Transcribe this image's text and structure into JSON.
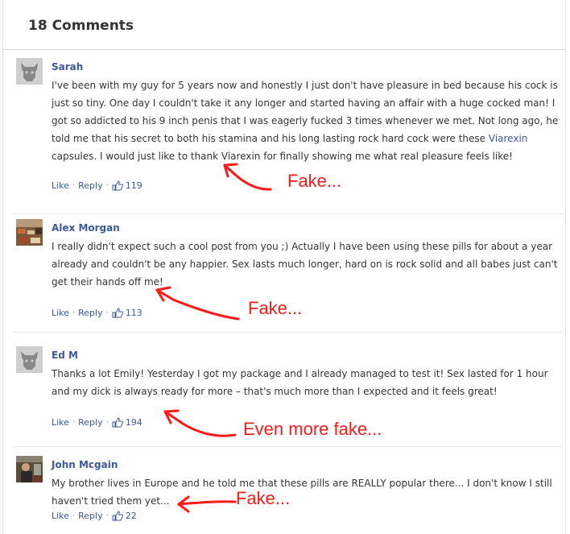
{
  "comments_header": {
    "title": "18 Comments"
  },
  "comments": [
    {
      "author": "Sarah",
      "avatar": "default-avatar-icon",
      "text_parts": [
        "I've been with my guy for 5 years now and honestly I just don't have pleasure in bed because his cock is just so tiny. One day I couldn't take it any longer and started having an affair with a huge cocked man! I got so addicted to his 9 inch penis that I was eagerly fucked 3 times whenever we met. Not long ago, he told me that his secret to both his stamina and his long lasting rock hard cock were these ",
        "Viarexin",
        " capsules. I would just like to thank Viarexin for finally showing me what real pleasure feels like!"
      ],
      "like_label": "Like",
      "reply_label": "Reply",
      "likes": "119"
    },
    {
      "author": "Alex Morgan",
      "avatar": "photo-avatar",
      "text": "I really didn't expect such a cool post from you ;) Actually I have been using these pills for about a year already and couldn't be any happier. Sex lasts much longer, hard on is rock solid and all babes just can't get their hands off me!",
      "like_label": "Like",
      "reply_label": "Reply",
      "likes": "113"
    },
    {
      "author": "Ed M",
      "avatar": "default-avatar-icon",
      "text": "Thanks a lot Emily! Yesterday I got my package and I already managed to test it! Sex lasted for 1 hour and my dick is always ready for more – that's much more than I expected and it feels great!",
      "like_label": "Like",
      "reply_label": "Reply",
      "likes": "194"
    },
    {
      "author": "John Mcgain",
      "avatar": "photo-avatar",
      "text": "My brother lives in Europe and he told me that these pills are REALLY popular there... I don't know I still haven't tried them yet...",
      "like_label": "Like",
      "reply_label": "Reply",
      "likes": "22"
    }
  ],
  "annotations": [
    "Fake...",
    "Fake...",
    "Even more fake...",
    "Fake..."
  ],
  "colors": {
    "link": "#3b5998",
    "text": "#333333",
    "annotation": "#ff1a1a"
  },
  "icons": {
    "like": "thumbs-up-icon"
  }
}
